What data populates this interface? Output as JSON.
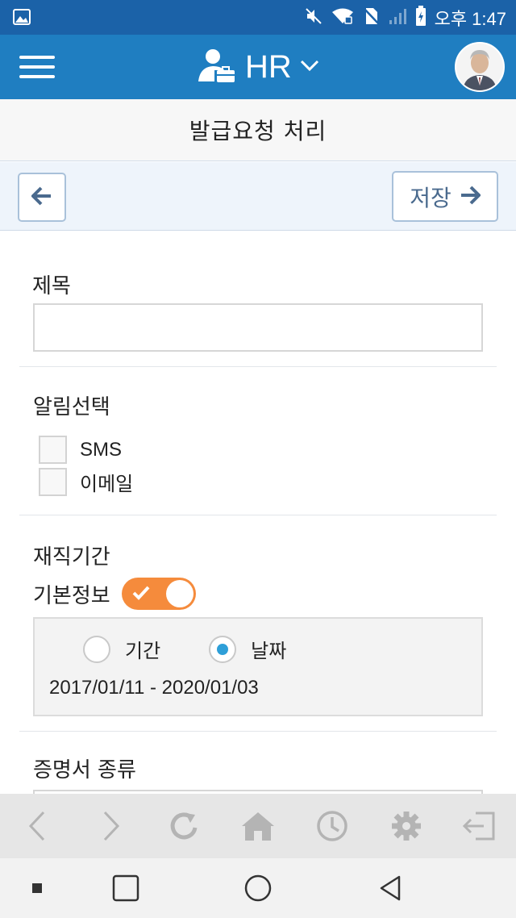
{
  "status_bar": {
    "time": "오후 1:47",
    "icons": [
      "image-icon",
      "mute-icon",
      "wifi-icon",
      "no-sim-icon",
      "signal-icon",
      "battery-icon"
    ]
  },
  "header": {
    "menu_icon": "hamburger-menu-icon",
    "app_name": "HR",
    "app_icon": "hr-person-icon",
    "dropdown_icon": "chevron-down-icon",
    "avatar": "user-avatar"
  },
  "page": {
    "title": "발급요청 처리"
  },
  "toolbar": {
    "back_icon": "arrow-left-icon",
    "save_label": "저장",
    "save_icon": "arrow-right-icon"
  },
  "form": {
    "subject_label": "제목",
    "subject_value": "",
    "notify_label": "알림선택",
    "notify_options": [
      {
        "label": "SMS",
        "checked": false
      },
      {
        "label": "이메일",
        "checked": false
      }
    ],
    "employment_label": "재직기간",
    "basic_info_label": "기본정보",
    "basic_info_on": true,
    "period_options": [
      {
        "label": "기간",
        "selected": false
      },
      {
        "label": "날짜",
        "selected": true
      }
    ],
    "date_range": "2017/01/11 - 2020/01/03",
    "cert_type_label": "증명서 종류"
  },
  "browser_bar": {
    "buttons": [
      "back-icon",
      "forward-icon",
      "refresh-icon",
      "home-icon",
      "history-icon",
      "settings-icon",
      "logout-icon"
    ]
  },
  "nav_bar": {
    "buttons": [
      "menu-dot-icon",
      "recents-icon",
      "home-circle-icon",
      "back-triangle-icon"
    ]
  },
  "colors": {
    "status_bar": "#1b62a8",
    "app_bar": "#1f7ec1",
    "toggle_on": "#f58b3c",
    "radio_selected": "#2e9fd8",
    "button_border": "#a9c1da"
  }
}
